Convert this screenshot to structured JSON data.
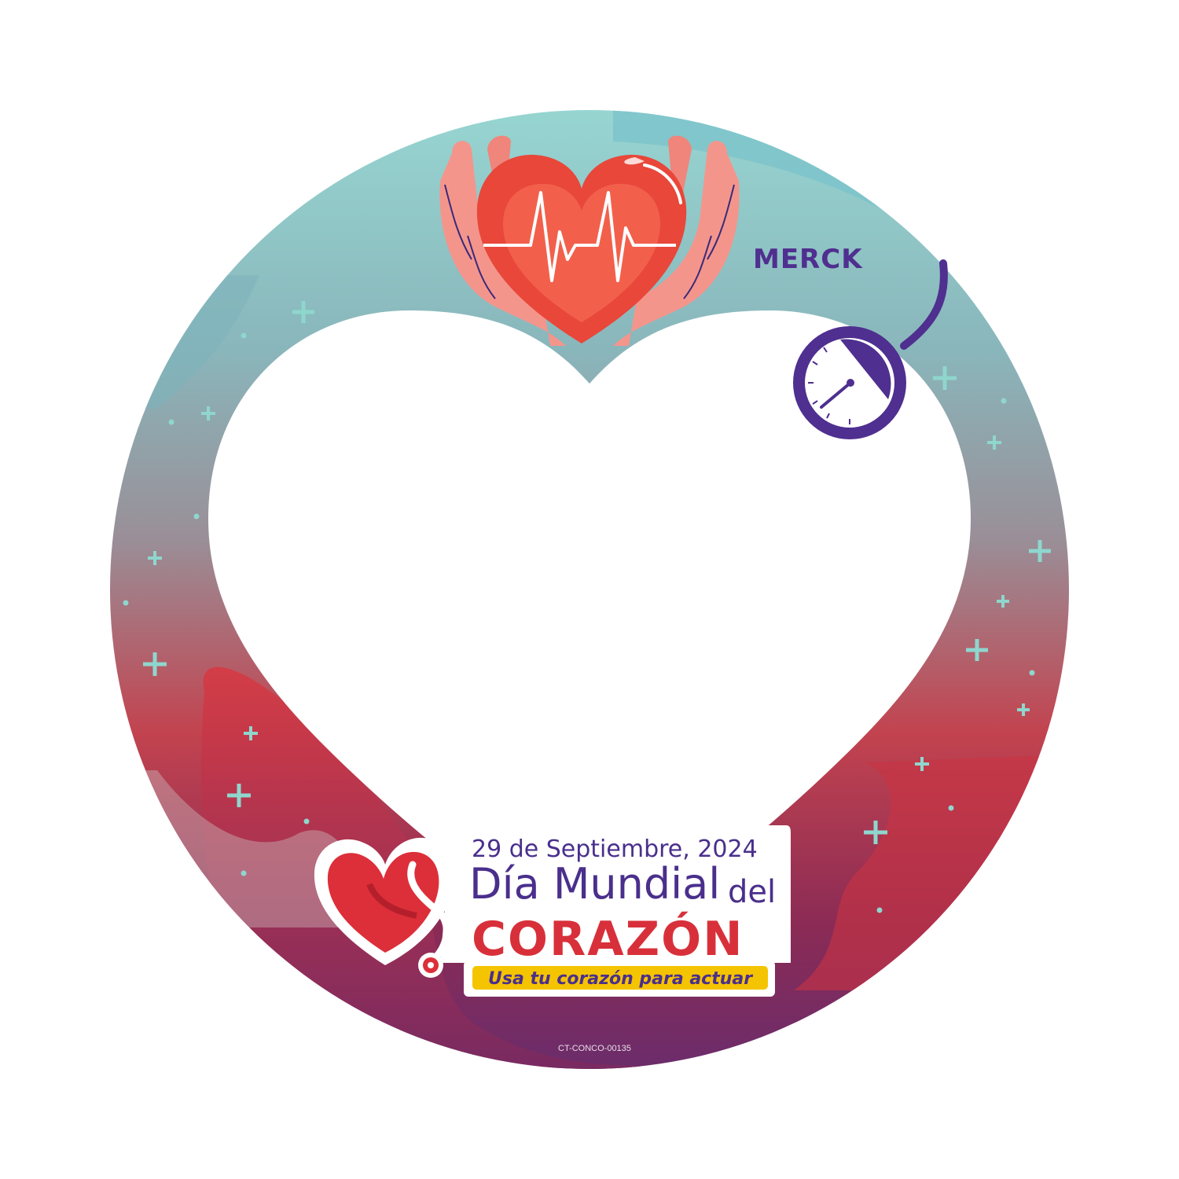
{
  "brand": {
    "logo_text": "MERCK"
  },
  "event": {
    "date": "29 de Septiembre, 2024",
    "title_line": "Día Mundial",
    "title_del": "del",
    "title_big": "CORAZÓN",
    "tagline": "Usa tu corazón para actuar"
  },
  "footer": {
    "code": "CT-CONCO-00135"
  },
  "colors": {
    "teal": "#97d5d1",
    "red": "#d8303a",
    "purple": "#6b2c6b",
    "brand_purple": "#4f2f8f",
    "tagline_bg": "#f5c400"
  },
  "icons": [
    "heart-in-hands-icon",
    "heartbeat-line-icon",
    "blood-pressure-gauge-icon",
    "stethoscope-heart-icon",
    "plus-sparkle-icon"
  ]
}
